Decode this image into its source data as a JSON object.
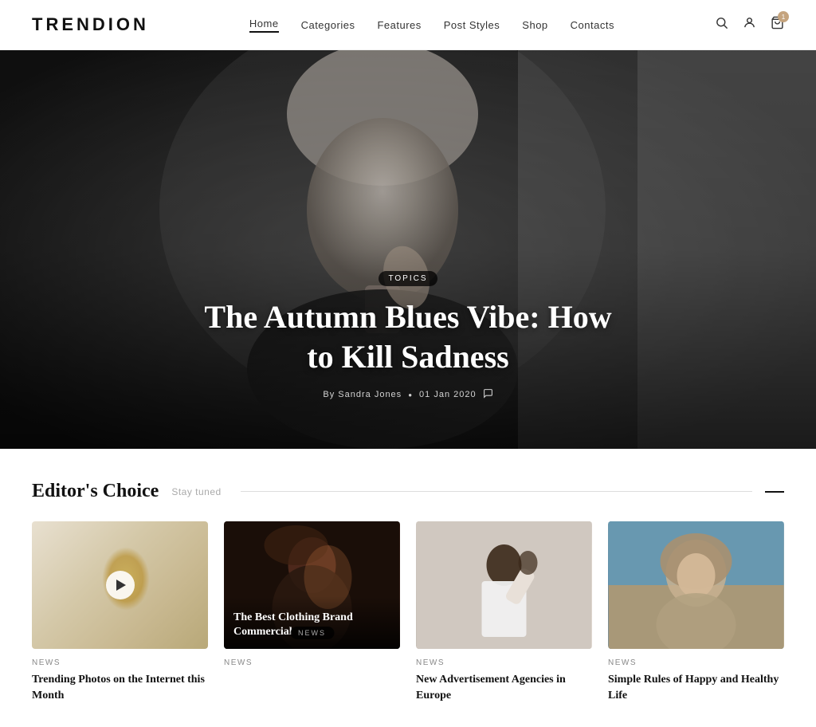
{
  "header": {
    "logo": "TRENDION",
    "nav": {
      "items": [
        {
          "label": "Home",
          "active": true
        },
        {
          "label": "Categories",
          "active": false
        },
        {
          "label": "Features",
          "active": false
        },
        {
          "label": "Post Styles",
          "active": false
        },
        {
          "label": "Shop",
          "active": false
        },
        {
          "label": "Contacts",
          "active": false
        }
      ]
    },
    "icons": {
      "search": "🔍",
      "user": "👤",
      "cart": "🛒",
      "cart_count": "1"
    }
  },
  "hero": {
    "tag": "TOPICS",
    "title": "The Autumn Blues Vibe: How to Kill Sadness",
    "author": "By Sandra Jones",
    "date": "01 Jan 2020",
    "comment_icon": "💬"
  },
  "editors_choice": {
    "title": "Editor's Choice",
    "subtitle": "Stay tuned"
  },
  "cards": [
    {
      "category": "NEWS",
      "title": "Trending Photos on the Internet this Month",
      "has_play": true,
      "img_type": "floral"
    },
    {
      "category": "NEWS",
      "title": "The Best Clothing Brand Commercial",
      "has_play": false,
      "img_type": "dark_portrait",
      "overlay_tag": "NEWS"
    },
    {
      "category": "NEWS",
      "title": "New Advertisement Agencies in Europe",
      "has_play": false,
      "img_type": "white_shirt"
    },
    {
      "category": "NEWS",
      "title": "Simple Rules of Happy and Healthy Life",
      "has_play": false,
      "img_type": "outdoor_portrait"
    }
  ]
}
